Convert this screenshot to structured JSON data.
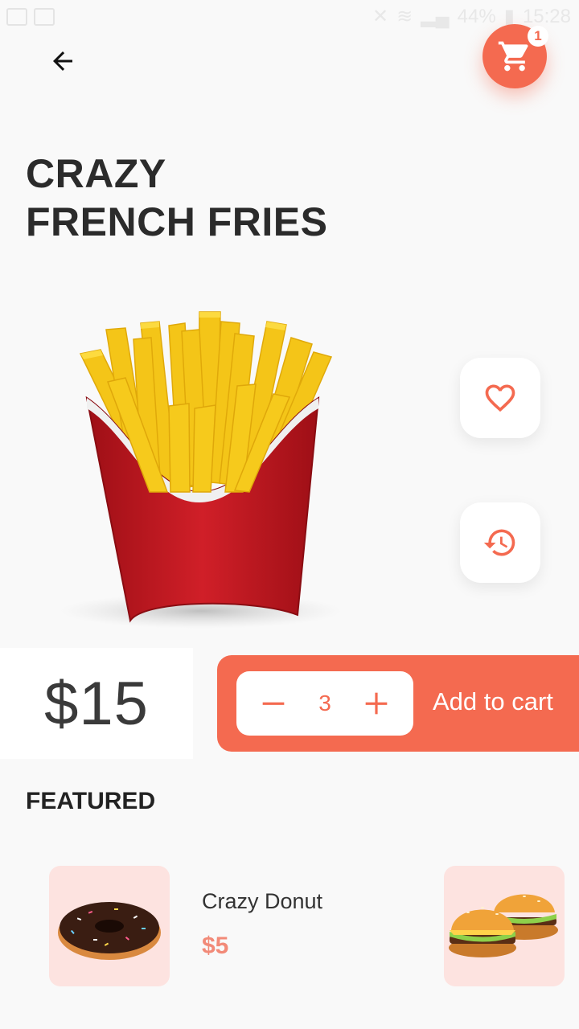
{
  "status_bar": {
    "battery": "44%",
    "time": "15:28"
  },
  "header": {
    "cart_badge_count": "1",
    "back_icon": "arrow-left-icon",
    "cart_icon": "shopping-cart-icon"
  },
  "product": {
    "title_line1": "CRAZY",
    "title_line2": "FRENCH FRIES",
    "price": "$15",
    "quantity": "3"
  },
  "actions": {
    "favorite_icon": "heart-icon",
    "history_icon": "history-icon",
    "add_to_cart_label": "Add to cart"
  },
  "featured": {
    "section_title": "FEATURED",
    "items": [
      {
        "name": "Crazy Donut",
        "price": "$5",
        "image": "donut"
      },
      {
        "image": "burger"
      }
    ]
  },
  "colors": {
    "accent": "#f46a50",
    "thumb_bg": "#fde3e0",
    "price_text": "#3a3a3a"
  }
}
